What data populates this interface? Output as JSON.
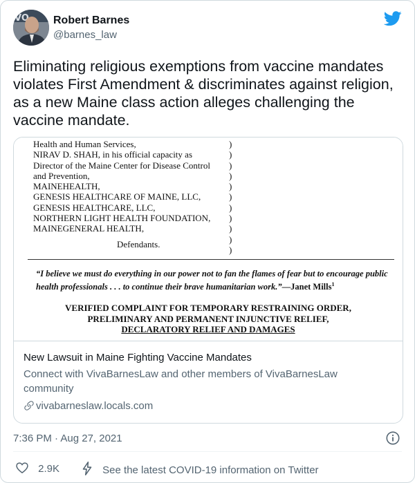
{
  "author": {
    "name": "Robert Barnes",
    "handle": "@barnes_law"
  },
  "icons": {
    "brand": "twitter-bird-icon",
    "avatar": "avatar",
    "link": "link-icon",
    "info": "info-icon",
    "like": "heart-icon",
    "covid": "lightning-icon"
  },
  "colors": {
    "twitter_blue": "#1d9bf0",
    "secondary_text": "#536471",
    "border": "#cfd9de"
  },
  "tweet": {
    "text": "Eliminating religious exemptions from vaccine mandates\nviolates First Amendment & discriminates against religion,\nas a new Maine class action alleges challenging the\nvaccine mandate."
  },
  "document": {
    "caption_lines": [
      "Health and Human Services,",
      "NIRAV D. SHAH, in his official capacity as",
      "Director of the Maine Center for Disease Control",
      "and Prevention,",
      "MAINEHEALTH,",
      "GENESIS HEALTHCARE OF MAINE, LLC,",
      "GENESIS HEALTHCARE, LLC,",
      "NORTHERN LIGHT HEALTH FOUNDATION,",
      "MAINEGENERAL HEALTH,"
    ],
    "defendants_label": "Defendants.",
    "paren": ")",
    "quote_text": "“I believe we must do everything in our power not to fan the flames of fear but to encourage public health professionals . . . to continue their brave humanitarian work.”",
    "quote_author": "—Janet Mills",
    "quote_footnote": "1",
    "complaint_line1": "VERIFIED COMPLAINT FOR TEMPORARY RESTRAINING ORDER,",
    "complaint_line2": "PRELIMINARY AND PERMANENT INJUNCTIVE RELIEF,",
    "complaint_line3": "DECLARATORY RELIEF AND DAMAGES"
  },
  "card": {
    "title": "New Lawsuit in Maine Fighting Vaccine Mandates",
    "description": "Connect with VivaBarnesLaw and other members of VivaBarnesLaw community",
    "domain": "vivabarneslaw.locals.com"
  },
  "meta": {
    "timestamp": "7:36 PM · Aug 27, 2021"
  },
  "actions": {
    "likes": "2.9K",
    "covid_info": "See the latest COVID-19 information on Twitter"
  }
}
